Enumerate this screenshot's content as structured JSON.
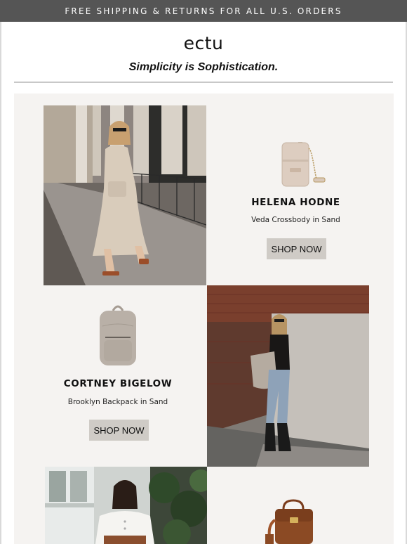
{
  "banner": {
    "text": "FREE SHIPPING & RETURNS FOR ALL U.S. ORDERS"
  },
  "brand": {
    "logo": "ectu",
    "tagline": "Simplicity is Sophistication."
  },
  "products": [
    {
      "influencer": "HELENA HODNE",
      "description": "Veda Crossbody in Sand",
      "cta": "SHOP NOW"
    },
    {
      "influencer": "CORTNEY BIGELOW",
      "description": "Brooklyn Backpack in Sand",
      "cta": "SHOP NOW"
    }
  ],
  "colors": {
    "banner": "#555555",
    "panel": "#f5f3f1",
    "button": "#cfcbc6"
  }
}
